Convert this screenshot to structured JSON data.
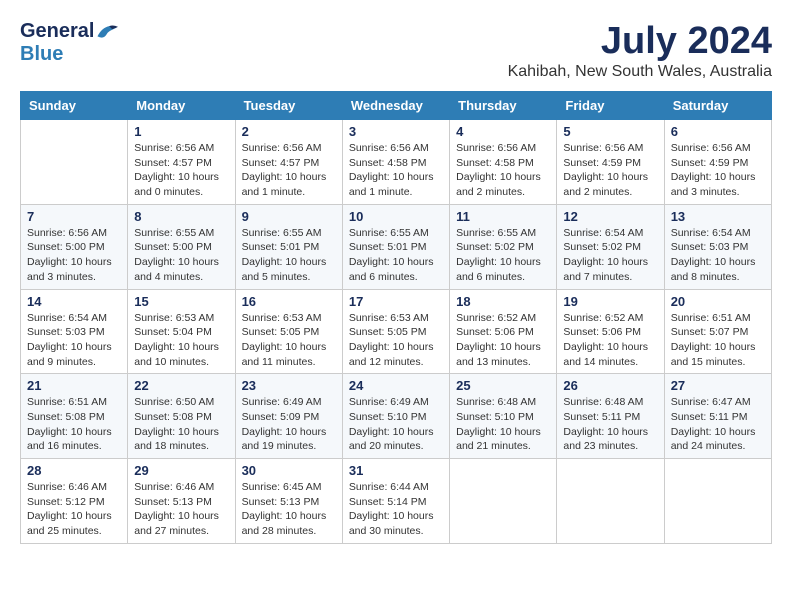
{
  "header": {
    "logo_general": "General",
    "logo_blue": "Blue",
    "month_year": "July 2024",
    "location": "Kahibah, New South Wales, Australia"
  },
  "weekdays": [
    "Sunday",
    "Monday",
    "Tuesday",
    "Wednesday",
    "Thursday",
    "Friday",
    "Saturday"
  ],
  "weeks": [
    [
      {
        "day": "",
        "info": ""
      },
      {
        "day": "1",
        "info": "Sunrise: 6:56 AM\nSunset: 4:57 PM\nDaylight: 10 hours\nand 0 minutes."
      },
      {
        "day": "2",
        "info": "Sunrise: 6:56 AM\nSunset: 4:57 PM\nDaylight: 10 hours\nand 1 minute."
      },
      {
        "day": "3",
        "info": "Sunrise: 6:56 AM\nSunset: 4:58 PM\nDaylight: 10 hours\nand 1 minute."
      },
      {
        "day": "4",
        "info": "Sunrise: 6:56 AM\nSunset: 4:58 PM\nDaylight: 10 hours\nand 2 minutes."
      },
      {
        "day": "5",
        "info": "Sunrise: 6:56 AM\nSunset: 4:59 PM\nDaylight: 10 hours\nand 2 minutes."
      },
      {
        "day": "6",
        "info": "Sunrise: 6:56 AM\nSunset: 4:59 PM\nDaylight: 10 hours\nand 3 minutes."
      }
    ],
    [
      {
        "day": "7",
        "info": "Sunrise: 6:56 AM\nSunset: 5:00 PM\nDaylight: 10 hours\nand 3 minutes."
      },
      {
        "day": "8",
        "info": "Sunrise: 6:55 AM\nSunset: 5:00 PM\nDaylight: 10 hours\nand 4 minutes."
      },
      {
        "day": "9",
        "info": "Sunrise: 6:55 AM\nSunset: 5:01 PM\nDaylight: 10 hours\nand 5 minutes."
      },
      {
        "day": "10",
        "info": "Sunrise: 6:55 AM\nSunset: 5:01 PM\nDaylight: 10 hours\nand 6 minutes."
      },
      {
        "day": "11",
        "info": "Sunrise: 6:55 AM\nSunset: 5:02 PM\nDaylight: 10 hours\nand 6 minutes."
      },
      {
        "day": "12",
        "info": "Sunrise: 6:54 AM\nSunset: 5:02 PM\nDaylight: 10 hours\nand 7 minutes."
      },
      {
        "day": "13",
        "info": "Sunrise: 6:54 AM\nSunset: 5:03 PM\nDaylight: 10 hours\nand 8 minutes."
      }
    ],
    [
      {
        "day": "14",
        "info": "Sunrise: 6:54 AM\nSunset: 5:03 PM\nDaylight: 10 hours\nand 9 minutes."
      },
      {
        "day": "15",
        "info": "Sunrise: 6:53 AM\nSunset: 5:04 PM\nDaylight: 10 hours\nand 10 minutes."
      },
      {
        "day": "16",
        "info": "Sunrise: 6:53 AM\nSunset: 5:05 PM\nDaylight: 10 hours\nand 11 minutes."
      },
      {
        "day": "17",
        "info": "Sunrise: 6:53 AM\nSunset: 5:05 PM\nDaylight: 10 hours\nand 12 minutes."
      },
      {
        "day": "18",
        "info": "Sunrise: 6:52 AM\nSunset: 5:06 PM\nDaylight: 10 hours\nand 13 minutes."
      },
      {
        "day": "19",
        "info": "Sunrise: 6:52 AM\nSunset: 5:06 PM\nDaylight: 10 hours\nand 14 minutes."
      },
      {
        "day": "20",
        "info": "Sunrise: 6:51 AM\nSunset: 5:07 PM\nDaylight: 10 hours\nand 15 minutes."
      }
    ],
    [
      {
        "day": "21",
        "info": "Sunrise: 6:51 AM\nSunset: 5:08 PM\nDaylight: 10 hours\nand 16 minutes."
      },
      {
        "day": "22",
        "info": "Sunrise: 6:50 AM\nSunset: 5:08 PM\nDaylight: 10 hours\nand 18 minutes."
      },
      {
        "day": "23",
        "info": "Sunrise: 6:49 AM\nSunset: 5:09 PM\nDaylight: 10 hours\nand 19 minutes."
      },
      {
        "day": "24",
        "info": "Sunrise: 6:49 AM\nSunset: 5:10 PM\nDaylight: 10 hours\nand 20 minutes."
      },
      {
        "day": "25",
        "info": "Sunrise: 6:48 AM\nSunset: 5:10 PM\nDaylight: 10 hours\nand 21 minutes."
      },
      {
        "day": "26",
        "info": "Sunrise: 6:48 AM\nSunset: 5:11 PM\nDaylight: 10 hours\nand 23 minutes."
      },
      {
        "day": "27",
        "info": "Sunrise: 6:47 AM\nSunset: 5:11 PM\nDaylight: 10 hours\nand 24 minutes."
      }
    ],
    [
      {
        "day": "28",
        "info": "Sunrise: 6:46 AM\nSunset: 5:12 PM\nDaylight: 10 hours\nand 25 minutes."
      },
      {
        "day": "29",
        "info": "Sunrise: 6:46 AM\nSunset: 5:13 PM\nDaylight: 10 hours\nand 27 minutes."
      },
      {
        "day": "30",
        "info": "Sunrise: 6:45 AM\nSunset: 5:13 PM\nDaylight: 10 hours\nand 28 minutes."
      },
      {
        "day": "31",
        "info": "Sunrise: 6:44 AM\nSunset: 5:14 PM\nDaylight: 10 hours\nand 30 minutes."
      },
      {
        "day": "",
        "info": ""
      },
      {
        "day": "",
        "info": ""
      },
      {
        "day": "",
        "info": ""
      }
    ]
  ]
}
